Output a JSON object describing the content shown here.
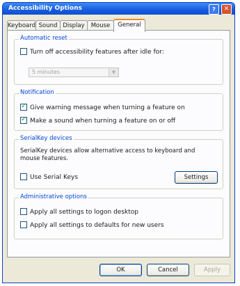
{
  "window": {
    "title": "Accessibility Options",
    "help_label": "?",
    "close_label": "✕"
  },
  "tabs": [
    "Keyboard",
    "Sound",
    "Display",
    "Mouse",
    "General"
  ],
  "active_tab": "General",
  "automatic_reset": {
    "title": "Automatic reset",
    "checkbox_label": "Turn off accessibility features after idle for:",
    "checked": false,
    "timeout_value": "5 minutes",
    "timeout_enabled": false
  },
  "notification": {
    "title": "Notification",
    "items": [
      {
        "label": "Give warning message when turning a feature on",
        "checked": true
      },
      {
        "label": "Make a sound when turning a feature on or off",
        "checked": true
      }
    ]
  },
  "serialkey": {
    "title": "SerialKey devices",
    "description": "SerialKey devices allow alternative access to keyboard and mouse features.",
    "checkbox_label": "Use Serial Keys",
    "checked": false,
    "settings_label": "Settings"
  },
  "administrative": {
    "title": "Administrative options",
    "items": [
      {
        "label": "Apply all settings to logon desktop",
        "checked": false
      },
      {
        "label": "Apply all settings to defaults for new users",
        "checked": false
      }
    ]
  },
  "buttons": {
    "ok": "OK",
    "cancel": "Cancel",
    "apply": "Apply"
  }
}
